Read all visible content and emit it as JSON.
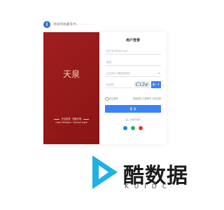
{
  "topbar": {
    "notice_text": "添加到收藏夹中，· · · · · · ·"
  },
  "brand": {
    "logo_text": "天泉",
    "slogan_cn": "开启智慧 · 照耀光明",
    "slogan_en": "Open Wisdom · Spread Light"
  },
  "login": {
    "title": "用户登录",
    "username_placeholder": "用户名/手机/Email",
    "password_placeholder": "密码",
    "select_value": "企业用户/请选择类别",
    "captcha_placeholder": "验证码",
    "captcha_code": "Ci3e",
    "captcha_refresh_label": "换一个",
    "remember_label": "记住登录",
    "links_text": "找回密码  注册帐号  立即注册",
    "submit_label": "登 录",
    "third_party_label": "第三方帐号登录"
  },
  "colors": {
    "brand_red": "#9c1b1b",
    "primary_blue": "#3b82f6"
  },
  "icons": [
    "info-icon",
    "qq-icon",
    "wechat-icon",
    "weibo-icon",
    "chevron-down-icon"
  ],
  "watermark": {
    "title": "酷数据",
    "subtitle": "KUIDC"
  }
}
